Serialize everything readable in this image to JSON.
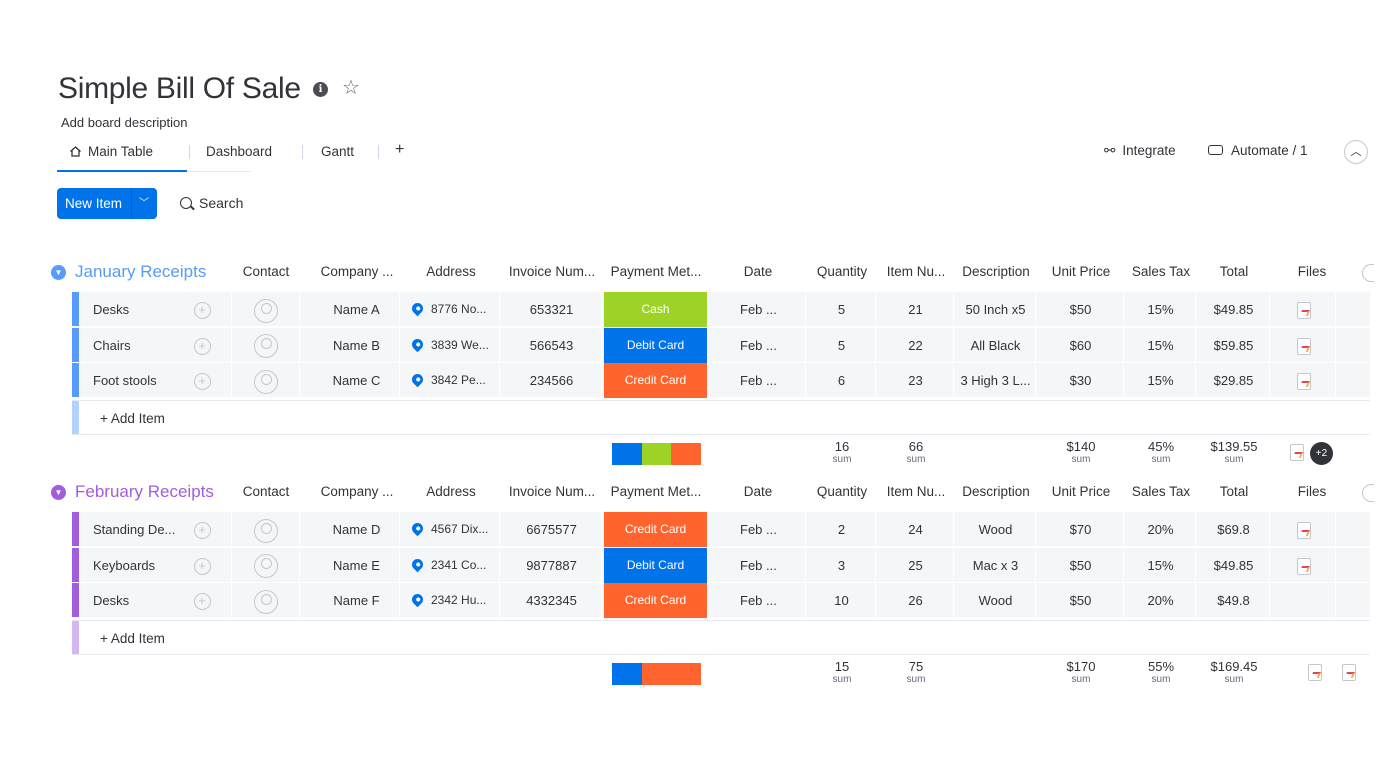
{
  "board": {
    "title": "Simple Bill Of Sale",
    "description": "Add board description",
    "info_icon": "info-icon",
    "star_icon": "star-icon"
  },
  "tabs": [
    {
      "label": "Main Table",
      "icon": "home-icon",
      "active": true
    },
    {
      "label": "Dashboard"
    },
    {
      "label": "Gantt"
    }
  ],
  "tab_add": "+",
  "toolbar": {
    "integrate": "Integrate",
    "automate": "Automate / 1",
    "new_item": "New Item",
    "search": "Search"
  },
  "columns": [
    "Contact",
    "Company ...",
    "Address",
    "Invoice Num...",
    "Payment Met...",
    "Date",
    "Quantity",
    "Item Nu...",
    "Description",
    "Unit Price",
    "Sales Tax",
    "Total",
    "Files"
  ],
  "colors": {
    "cash": "#9cd326",
    "debit": "#0073ea",
    "credit": "#ff642e",
    "jan_group": "#579bfc",
    "feb_group": "#a25ddc"
  },
  "groups": [
    {
      "title": "January Receipts",
      "items": [
        {
          "name": "Desks",
          "company": "Name A",
          "address": "8776 No...",
          "invoice": "653321",
          "payment": "Cash",
          "date": "Feb ...",
          "quantity": "5",
          "item_num": "21",
          "description": "50 Inch x5",
          "unit_price": "$50",
          "sales_tax": "15%",
          "total": "$49.85",
          "files": 1
        },
        {
          "name": "Chairs",
          "company": "Name B",
          "address": "3839 We...",
          "invoice": "566543",
          "payment": "Debit Card",
          "date": "Feb ...",
          "quantity": "5",
          "item_num": "22",
          "description": "All Black",
          "unit_price": "$60",
          "sales_tax": "15%",
          "total": "$59.85",
          "files": 1
        },
        {
          "name": "Foot stools",
          "company": "Name C",
          "address": "3842 Pe...",
          "invoice": "234566",
          "payment": "Credit Card",
          "date": "Feb ...",
          "quantity": "6",
          "item_num": "23",
          "description": "3 High 3 L...",
          "unit_price": "$30",
          "sales_tax": "15%",
          "total": "$29.85",
          "files": 1
        }
      ],
      "add_item": "+ Add Item",
      "summary": {
        "quantity": "16",
        "item_num": "66",
        "unit_price": "$140",
        "sales_tax": "45%",
        "total": "$139.55",
        "sum_label": "sum",
        "files_more": "+2"
      },
      "payment_distribution": {
        "cash": 1,
        "debit": 1,
        "credit": 1
      }
    },
    {
      "title": "February Receipts",
      "items": [
        {
          "name": "Standing De...",
          "company": "Name D",
          "address": "4567 Dix...",
          "invoice": "6675577",
          "payment": "Credit Card",
          "date": "Feb ...",
          "quantity": "2",
          "item_num": "24",
          "description": "Wood",
          "unit_price": "$70",
          "sales_tax": "20%",
          "total": "$69.8",
          "files": 1
        },
        {
          "name": "Keyboards",
          "company": "Name E",
          "address": "2341 Co...",
          "invoice": "9877887",
          "payment": "Debit Card",
          "date": "Feb ...",
          "quantity": "3",
          "item_num": "25",
          "description": "Mac x 3",
          "unit_price": "$50",
          "sales_tax": "15%",
          "total": "$49.85",
          "files": 1
        },
        {
          "name": "Desks",
          "company": "Name F",
          "address": "2342 Hu...",
          "invoice": "4332345",
          "payment": "Credit Card",
          "date": "Feb ...",
          "quantity": "10",
          "item_num": "26",
          "description": "Wood",
          "unit_price": "$50",
          "sales_tax": "20%",
          "total": "$49.8",
          "files": 0
        }
      ],
      "add_item": "+ Add Item",
      "summary": {
        "quantity": "15",
        "item_num": "75",
        "unit_price": "$170",
        "sales_tax": "55%",
        "total": "$169.45",
        "sum_label": "sum",
        "files_more": ""
      },
      "payment_distribution": {
        "cash": 0,
        "debit": 1,
        "credit": 2
      }
    }
  ]
}
